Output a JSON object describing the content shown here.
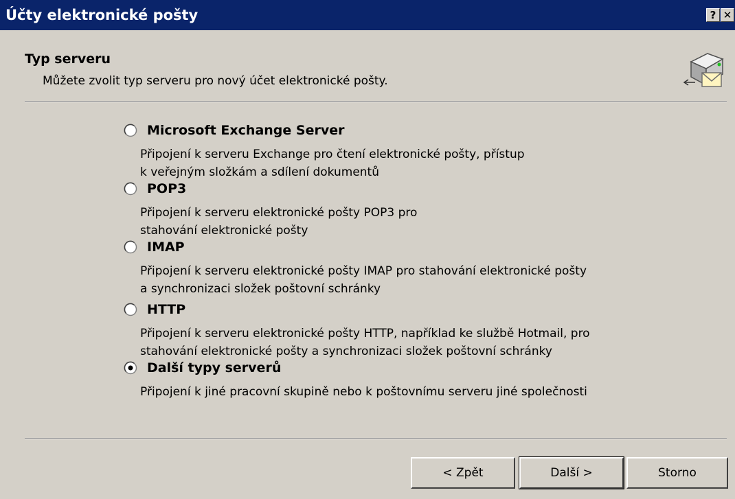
{
  "window": {
    "title": "Účty elektronické pošty",
    "help_label": "?",
    "close_label": "✕"
  },
  "header": {
    "title": "Typ serveru",
    "subtitle": "Můžete zvolit typ serveru pro nový účet elektronické pošty.",
    "icon": "mail-server-icon"
  },
  "options": [
    {
      "label": "Microsoft Exchange Server",
      "desc1": "Připojení k serveru Exchange pro čtení elektronické pošty, přístup",
      "desc2": "k veřejným složkám a sdílení dokumentů",
      "selected": false
    },
    {
      "label": "POP3",
      "desc1": "Připojení k serveru elektronické pošty POP3 pro",
      "desc2": "stahování elektronické pošty",
      "selected": false
    },
    {
      "label": "IMAP",
      "desc1": "Připojení k serveru elektronické pošty IMAP pro stahování elektronické pošty",
      "desc2": "a synchronizaci složek poštovní schránky",
      "selected": false
    },
    {
      "label": "HTTP",
      "desc1": "Připojení k serveru elektronické pošty HTTP, například ke službě Hotmail, pro",
      "desc2": "stahování elektronické pošty a synchronizaci složek poštovní schránky",
      "selected": false
    },
    {
      "label": "Další typy serverů",
      "desc1": "Připojení k jiné pracovní skupině nebo k poštovnímu serveru jiné společnosti",
      "desc2": "",
      "selected": true
    }
  ],
  "buttons": {
    "back": "< Zpět",
    "next": "Další >",
    "cancel": "Storno"
  },
  "colors": {
    "titlebar": "#0a246a",
    "dialog_bg": "#d4d0c8"
  }
}
